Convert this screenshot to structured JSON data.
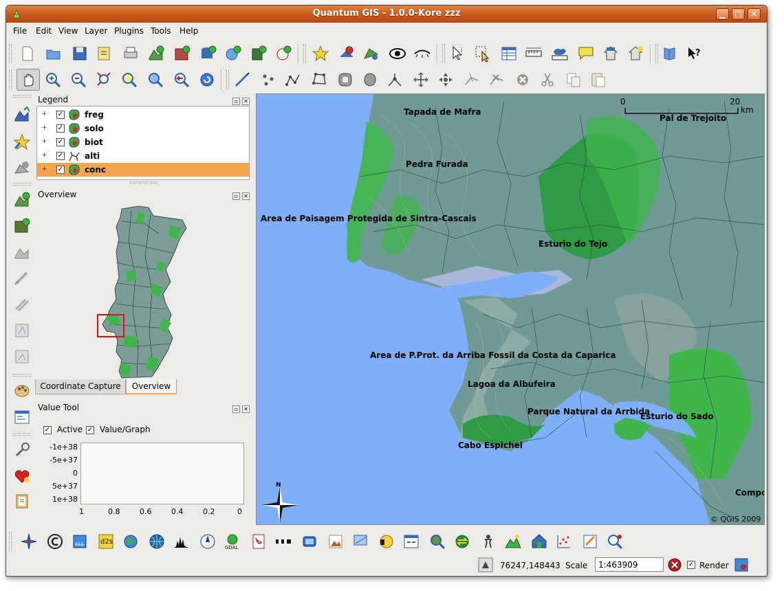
{
  "window": {
    "title": "Quantum GIS - 1.0.0-Kore  zzz",
    "buttons": {
      "minimize": "▁",
      "maximize": "□",
      "close": "✕"
    }
  },
  "menu": [
    "File",
    "Edit",
    "View",
    "Layer",
    "Plugins",
    "Tools",
    "Help"
  ],
  "legend": {
    "title": "Legend",
    "layers": [
      {
        "name": "freg",
        "checked": true,
        "type": "polygon",
        "selected": false
      },
      {
        "name": "solo",
        "checked": true,
        "type": "polygon",
        "selected": false
      },
      {
        "name": "biot",
        "checked": true,
        "type": "polygon",
        "selected": false
      },
      {
        "name": "alti",
        "checked": true,
        "type": "line",
        "selected": false
      },
      {
        "name": "conc",
        "checked": true,
        "type": "polygon",
        "selected": true
      }
    ]
  },
  "overview": {
    "title": "Overview"
  },
  "tabs": [
    {
      "label": "Coordinate Capture",
      "active": false
    },
    {
      "label": "Overview",
      "active": true
    }
  ],
  "value_tool": {
    "title": "Value Tool",
    "active_label": "Active",
    "graph_label": "Value/Graph",
    "y_ticks": [
      "-1e+38",
      "-5e+37",
      "0",
      "5e+37",
      "1e+38"
    ],
    "x_ticks": [
      "1",
      "0.8",
      "0.6",
      "0.4",
      "0.2",
      "0"
    ]
  },
  "map": {
    "labels": [
      {
        "id": "tapada",
        "text": "Tapada de Mafra"
      },
      {
        "id": "trejoito",
        "text": "Pal de Trejoito"
      },
      {
        "id": "pedra",
        "text": "Pedra Furada"
      },
      {
        "id": "sintra",
        "text": "Area de Paisagem Protegida de Sintra-Cascais"
      },
      {
        "id": "tejo",
        "text": "Esturio do Tejo"
      },
      {
        "id": "arriba",
        "text": "Area de P.Prot. da Arriba Fossil da Costa da Caparica"
      },
      {
        "id": "albufeira",
        "text": "Lagoa da Albufeira"
      },
      {
        "id": "arrbida",
        "text": "Parque Natural da Arrbida"
      },
      {
        "id": "sado",
        "text": "Esturio do Sado"
      },
      {
        "id": "espichel",
        "text": "Cabo Espichel"
      },
      {
        "id": "compo",
        "text": "Compo"
      }
    ],
    "scalebar": {
      "start": "0",
      "end": "20",
      "unit": "km"
    },
    "copyright": "© QGIS 2009",
    "north_label": "N"
  },
  "status": {
    "coordinates": "76247,148443",
    "scale_label": "Scale",
    "scale_value": "1:463909",
    "render_label": "Render",
    "render_checked": true
  },
  "colors": {
    "title_bar": "#c9561c",
    "selection": "#f6a44e",
    "water": "#7fb0f7",
    "land": "#6f9a96",
    "protected_area": "#33b54a"
  }
}
